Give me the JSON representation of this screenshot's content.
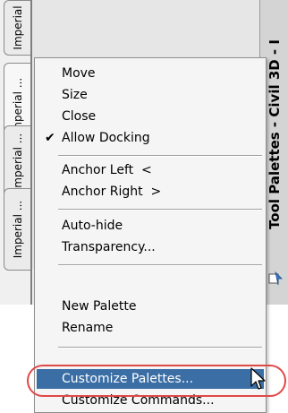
{
  "tabs": [
    {
      "label": "Imperial"
    },
    {
      "label": "Imperial ..."
    },
    {
      "label": "Imperial ..."
    },
    {
      "label": "Imperial ..."
    }
  ],
  "titlebar": {
    "text": "Tool Palettes - Civil 3D - I"
  },
  "menu": {
    "move": "Move",
    "size": "Size",
    "close": "Close",
    "allow_docking": "Allow Docking",
    "allow_docking_check": "✔",
    "anchor_left": "Anchor Left  <",
    "anchor_right": "Anchor Right  >",
    "auto_hide": "Auto-hide",
    "transparency": "Transparency...",
    "new_palette": "New Palette",
    "rename": "Rename",
    "customize_palettes": "Customize Palettes...",
    "customize_commands": "Customize Commands..."
  },
  "colors": {
    "highlight": "#3a6ea5",
    "annotation_ring": "#e04848"
  }
}
